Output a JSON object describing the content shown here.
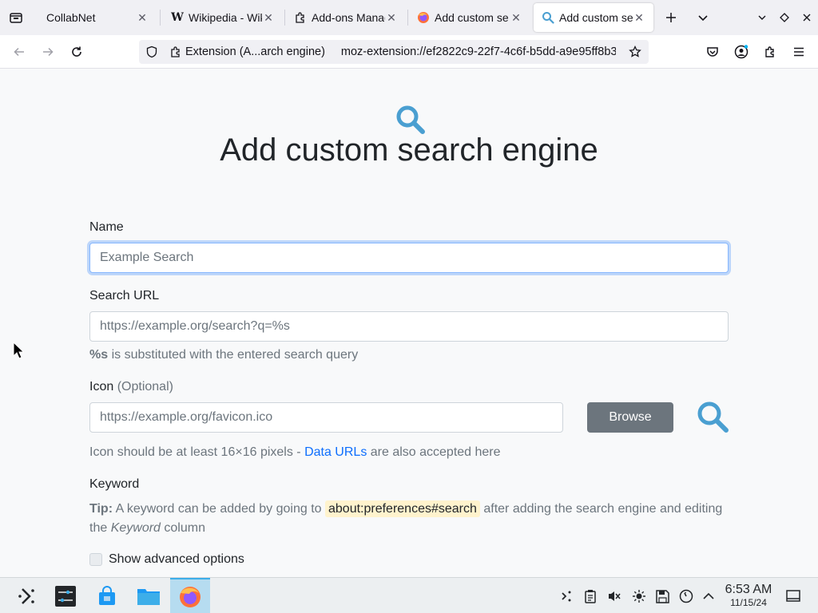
{
  "browser": {
    "tabs": [
      {
        "label": "CollabNet",
        "icon": "none"
      },
      {
        "label": "Wikipedia - Wik",
        "icon": "wikipedia-icon"
      },
      {
        "label": "Add-ons Manag",
        "icon": "puzzle-icon"
      },
      {
        "label": "Add custom se",
        "icon": "firefox-icon"
      },
      {
        "label": "Add custom se",
        "icon": "search-icon"
      }
    ],
    "selected_tab_index": 4,
    "identity_label": "Extension (A...arch engine)",
    "url": "moz-extension://ef2822c9-22f7-4c6f-b5dd-a9e95ff8b3"
  },
  "page": {
    "title": "Add custom search engine",
    "name_label": "Name",
    "name_placeholder": "Example Search",
    "search_url_label": "Search URL",
    "search_url_placeholder": "https://example.org/search?q=%s",
    "search_url_help_bold": "%s",
    "search_url_help_rest": " is substituted with the entered search query",
    "icon_label": "Icon",
    "icon_optional": "(Optional)",
    "icon_placeholder": "https://example.org/favicon.ico",
    "browse_label": "Browse",
    "icon_help_pre": "Icon should be at least 16×16 pixels - ",
    "icon_help_link": "Data URLs",
    "icon_help_post": " are also accepted here",
    "keyword_label": "Keyword",
    "tip_bold": "Tip:",
    "tip_pre": " A keyword can be added by going to ",
    "tip_code": "about:preferences#search",
    "tip_mid": " after adding the search engine and editing the ",
    "tip_em": "Keyword",
    "tip_post": " column",
    "advanced_label": "Show advanced options"
  },
  "taskbar": {
    "time": "6:53 AM",
    "date": "11/15/24"
  },
  "colors": {
    "accent_icon": "#4a9fd1",
    "link": "#0d6efd",
    "button_secondary": "#6c757d",
    "code_highlight": "#fff3cd"
  }
}
